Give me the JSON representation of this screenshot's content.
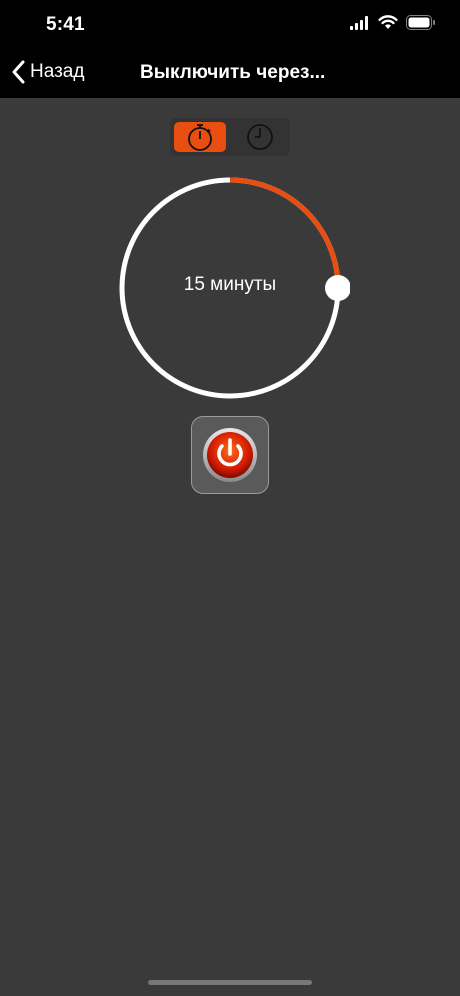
{
  "status_bar": {
    "time": "5:41"
  },
  "nav": {
    "back_label": "Назад",
    "title": "Выключить через..."
  },
  "mode_selector": {
    "options": [
      "timer-icon",
      "clock-icon"
    ],
    "selected": "timer-icon"
  },
  "timer": {
    "label": "15 минуты",
    "progress_fraction": 0.25
  },
  "power_button": {
    "icon": "power-icon"
  },
  "colors": {
    "accent": "#e84e0f",
    "background": "#3a3a3a",
    "ring": "#ffffff"
  }
}
